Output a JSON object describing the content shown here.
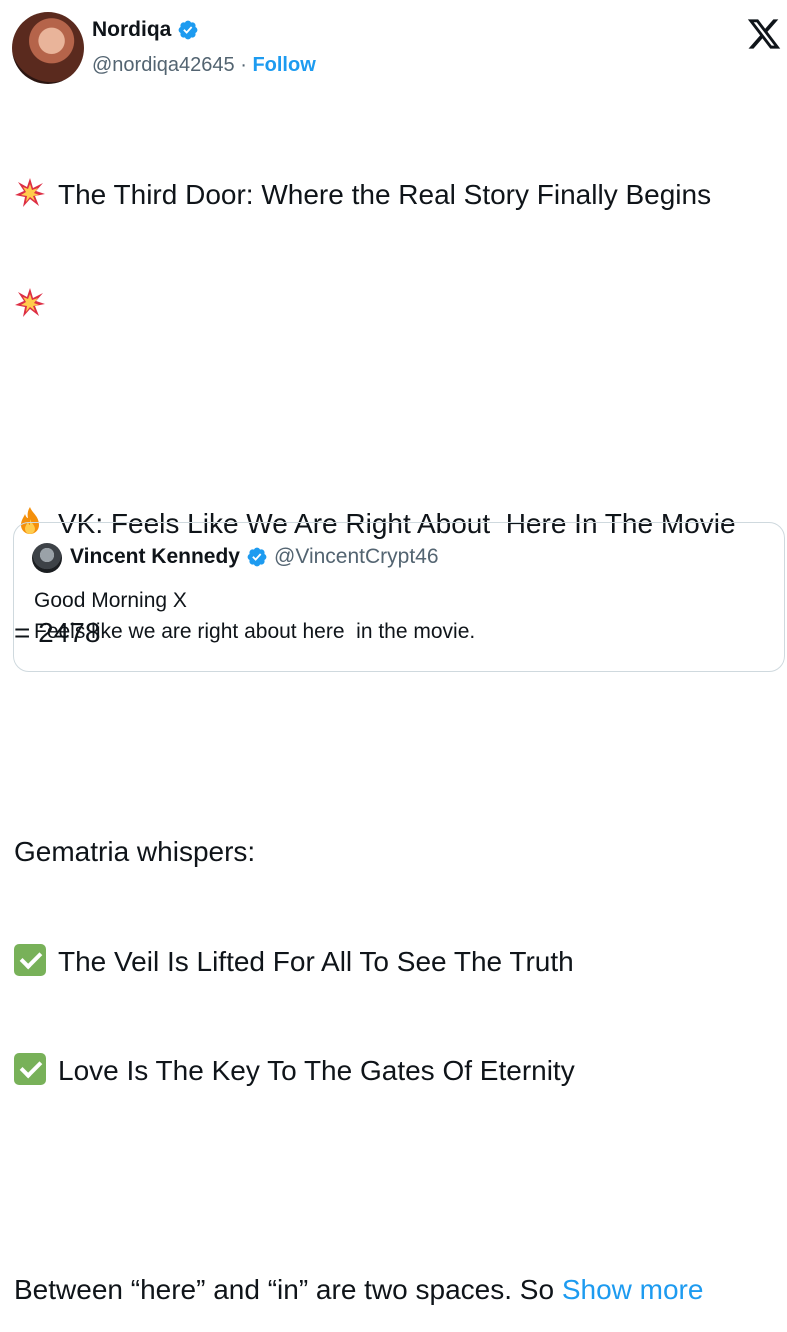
{
  "author": {
    "display_name": "Nordiqa",
    "handle": "@nordiqa42645",
    "separator": "·",
    "follow_label": "Follow",
    "verified": true
  },
  "tweet": {
    "line1": "The Third Door: Where the Real Story Finally Begins",
    "line3": "VK: Feels Like We Are Right About  Here In The Movie",
    "line4": "= 2478",
    "line6": "Gematria whispers:",
    "line7": "The Veil Is Lifted For All To See The Truth",
    "line8": "Love Is The Key To The Gates Of Eternity",
    "line10": "Between “here” and “in” are two spaces. So",
    "show_more": "Show more"
  },
  "quoted": {
    "display_name": "Vincent Kennedy",
    "handle": "@VincentCrypt46",
    "verified": true,
    "line1": "Good Morning X",
    "line2": "Feels like we are right about here  in the movie."
  },
  "icons": {
    "collision": "collision-emoji",
    "fire": "fire-emoji",
    "check": "check-mark-emoji",
    "x_logo": "x-logo-icon"
  },
  "colors": {
    "accent": "#1d9bf0",
    "muted": "#536471",
    "check_green": "#78b159"
  }
}
